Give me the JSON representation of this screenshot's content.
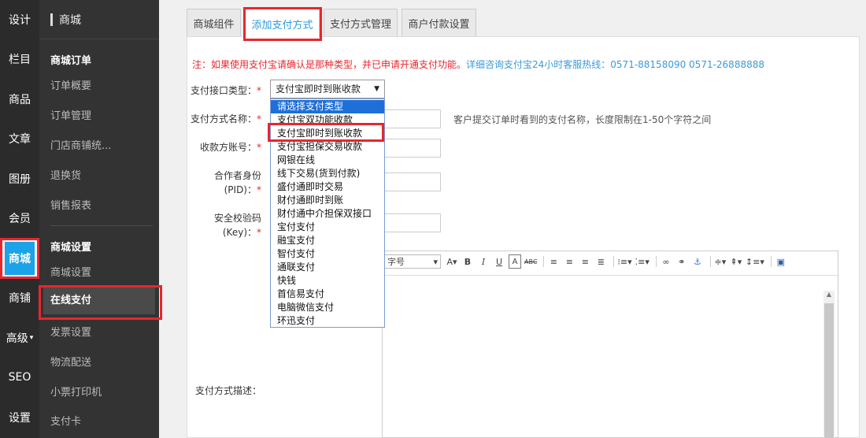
{
  "rail": [
    {
      "label": "设计"
    },
    {
      "label": "栏目"
    },
    {
      "label": "商品"
    },
    {
      "label": "文章"
    },
    {
      "label": "图册"
    },
    {
      "label": "会员"
    },
    {
      "label": "商城"
    },
    {
      "label": "商铺"
    },
    {
      "label": "高级"
    },
    {
      "label": "SEO"
    },
    {
      "label": "设置"
    }
  ],
  "submenu": {
    "title": "商城",
    "order_section": "商城订单",
    "order_items": [
      "订单概要",
      "订单管理",
      "门店商铺统...",
      "退换货",
      "销售报表"
    ],
    "settings_section": "商城设置",
    "settings_items": [
      "商城设置",
      "在线支付",
      "发票设置",
      "物流配送",
      "小票打印机",
      "支付卡"
    ]
  },
  "tabs": [
    "商城组件",
    "添加支付方式",
    "支付方式管理",
    "商户付款设置"
  ],
  "notice": {
    "red": "注：如果使用支付宝请确认是那种类型，并已申请开通支付功能。",
    "blue": "详细咨询支付宝24小时客服热线：0571-88158090 0571-26888888"
  },
  "form": {
    "type_label": "支付接口类型：",
    "name_label": "支付方式名称：",
    "name_hint": "客户提交订单时看到的支付名称，长度限制在1-50个字符之间",
    "account_label": "收款方账号：",
    "pid_label_1": "合作者身份",
    "pid_label_2": "(PID)：",
    "key_label_1": "安全校验码",
    "key_label_2": "(Key)：",
    "desc_label": "支付方式描述：",
    "required_mark": "*"
  },
  "select": {
    "value": "支付宝即时到账收款",
    "options": [
      "请选择支付类型",
      "支付宝双功能收款",
      "支付宝即时到账收款",
      "支付宝担保交易收款",
      "网银在线",
      "线下交易(货到付款)",
      "盛付通即时交易",
      "财付通即时到账",
      "财付通中介担保双接口",
      "宝付支付",
      "融宝支付",
      "智付支付",
      "通联支付",
      "快钱",
      "首信易支付",
      "电脑微信支付",
      "环迅支付"
    ],
    "highlighted_index": 0
  },
  "editor": {
    "font_size_label": "字号"
  },
  "colors": {
    "accent": "#1aa3e8",
    "highlight": "#e8262d",
    "link": "#3a9ad9"
  }
}
